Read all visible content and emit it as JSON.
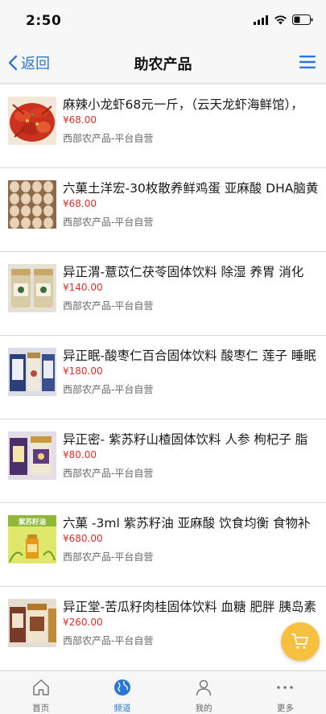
{
  "status_bar": {
    "time": "2:50"
  },
  "nav": {
    "back_label": "返回",
    "title": "助农产品"
  },
  "products": [
    {
      "title": "麻辣小龙虾68元一斤，（云天龙虾海鲜馆），",
      "price": "¥68.00",
      "source": "西部农产品-平台自营",
      "thumb": "crayfish"
    },
    {
      "title": "六菓土洋宏-30枚散养鲜鸡蛋 亚麻酸 DHA脑黄",
      "price": "¥68.00",
      "source": "西部农产品-平台自营",
      "thumb": "eggs"
    },
    {
      "title": "异正渭-薏苡仁茯苓固体饮料 除湿 养胃 消化",
      "price": "¥140.00",
      "source": "西部农产品-平台自营",
      "thumb": "jar-white"
    },
    {
      "title": "异正眠-酸枣仁百合固体饮料 酸枣仁 莲子 睡眠",
      "price": "¥180.00",
      "source": "西部农产品-平台自营",
      "thumb": "jar-box"
    },
    {
      "title": "异正密- 紫苏籽山楂固体饮料 人参 枸杞子 脂",
      "price": "¥80.00",
      "source": "西部农产品-平台自营",
      "thumb": "jar-purple"
    },
    {
      "title": "六菓 -3ml 紫苏籽油 亚麻酸 饮食均衡 食物补",
      "price": "¥680.00",
      "source": "西部农产品-平台自营",
      "thumb": "oil"
    },
    {
      "title": "异正堂-苦瓜籽肉桂固体饮料 血糖 肥胖 胰岛素",
      "price": "¥260.00",
      "source": "西部农产品-平台自营",
      "thumb": "jar-brown"
    }
  ],
  "oil_label_text": "紫苏籽油",
  "tabs": [
    {
      "label": "首页",
      "icon": "home-icon",
      "active": false
    },
    {
      "label": "频道",
      "icon": "globe-icon",
      "active": true
    },
    {
      "label": "我的",
      "icon": "user-icon",
      "active": false
    },
    {
      "label": "更多",
      "icon": "more-icon",
      "active": false
    }
  ],
  "colors": {
    "accent": "#2a77d6",
    "price": "#e0302a",
    "cart_fab": "#f6c040"
  }
}
